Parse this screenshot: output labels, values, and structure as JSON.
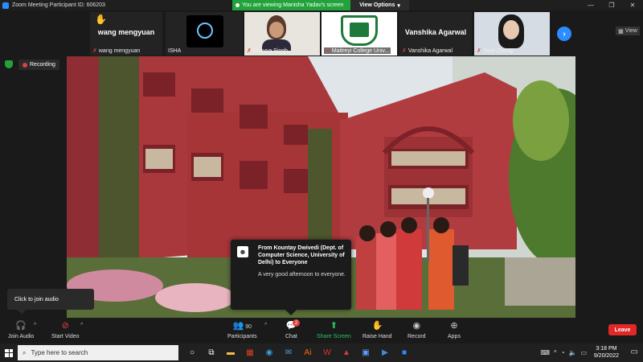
{
  "window": {
    "title": "Zoom Meeting Participant ID: 606203",
    "controls": [
      "—",
      "❐",
      "✕"
    ]
  },
  "banner": {
    "viewing_text": "You are viewing Manisha Yadav's screen",
    "view_options": "View Options",
    "view_options_caret": "▾"
  },
  "gallery": {
    "tiles": [
      {
        "name": "wang mengyuan",
        "big_name": "wang mengyuan",
        "muted": true,
        "raised_hand": true
      },
      {
        "name": "ISHA",
        "muted": false
      },
      {
        "name": "Bhavya Singh",
        "muted": true
      },
      {
        "name": "Maitreyi College Univ...",
        "muted": true
      },
      {
        "name": "Vanshika Agarwal",
        "big_name": "Vanshika Agarwal",
        "muted": true
      },
      {
        "name": "Jane Zheng",
        "muted": true
      }
    ],
    "next_icon": "›",
    "view_label": "View"
  },
  "status": {
    "recording_label": "Recording"
  },
  "chat_popup": {
    "from": "From Kountay Dwivedi (Dept. of Computer Science, University of Delhi) to Everyone",
    "message": "A very good afternoon to everyone."
  },
  "tooltip": {
    "text": "Click to join audio"
  },
  "toolbar": {
    "join_audio": "Join Audio",
    "start_video": "Start Video",
    "participants": "Participants",
    "participants_count": "90",
    "chat": "Chat",
    "chat_badge": "2",
    "share_screen": "Share Screen",
    "raise_hand": "Raise Hand",
    "record": "Record",
    "apps": "Apps",
    "leave": "Leave",
    "caret": "^"
  },
  "taskbar": {
    "search_placeholder": "Type here to search",
    "time": "3:18 PM",
    "date": "9/20/2022"
  },
  "colors": {
    "accent": "#2d8cff",
    "share_green": "#22c55e",
    "leave_red": "#e02828",
    "banner_green": "#22a23a"
  }
}
